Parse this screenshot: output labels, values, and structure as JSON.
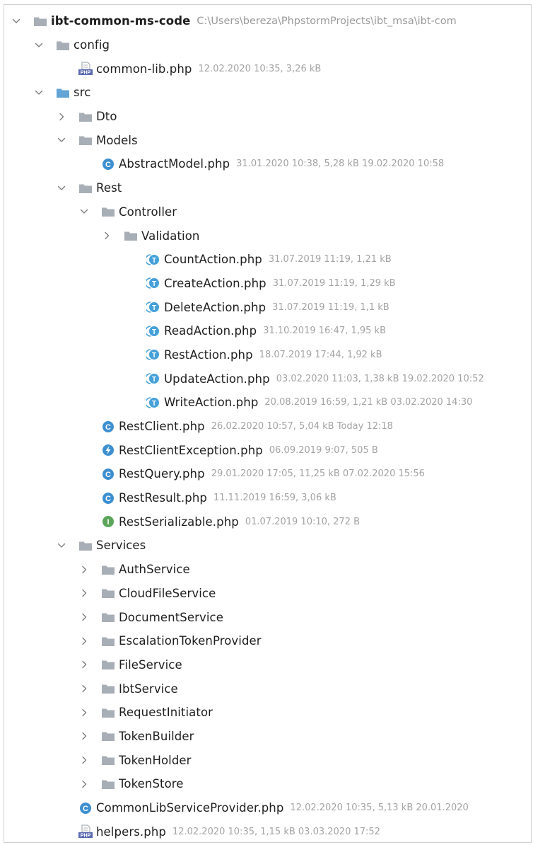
{
  "tree": {
    "rows": [
      {
        "type": "folder",
        "expanded": true,
        "depth": 0,
        "name": "ibt-common-ms-code",
        "meta": "C:\\Users\\bereza\\PhpstormProjects\\ibt_msa\\ibt-com",
        "bold": true,
        "icon": "project-folder-icon"
      },
      {
        "type": "folder",
        "expanded": true,
        "depth": 1,
        "name": "config",
        "meta": "",
        "icon": "folder-icon"
      },
      {
        "type": "file",
        "depth": 2,
        "name": "common-lib.php",
        "meta": "12.02.2020 10:35, 3,26 kB",
        "icon": "php-file-icon"
      },
      {
        "type": "folder",
        "expanded": true,
        "depth": 1,
        "name": "src",
        "meta": "",
        "icon": "source-folder-icon"
      },
      {
        "type": "folder",
        "expanded": false,
        "depth": 2,
        "name": "Dto",
        "meta": "",
        "icon": "folder-icon"
      },
      {
        "type": "folder",
        "expanded": true,
        "depth": 2,
        "name": "Models",
        "meta": "",
        "icon": "folder-icon"
      },
      {
        "type": "file",
        "depth": 3,
        "name": "AbstractModel.php",
        "meta": "31.01.2020 10:38, 5,28 kB 19.02.2020 10:58",
        "icon": "class-icon"
      },
      {
        "type": "folder",
        "expanded": true,
        "depth": 2,
        "name": "Rest",
        "meta": "",
        "icon": "folder-icon"
      },
      {
        "type": "folder",
        "expanded": true,
        "depth": 3,
        "name": "Controller",
        "meta": "",
        "icon": "folder-icon"
      },
      {
        "type": "folder",
        "expanded": false,
        "depth": 4,
        "name": "Validation",
        "meta": "",
        "icon": "folder-icon"
      },
      {
        "type": "file",
        "depth": 5,
        "name": "CountAction.php",
        "meta": "31.07.2019 11:19, 1,21 kB",
        "icon": "trait-icon"
      },
      {
        "type": "file",
        "depth": 5,
        "name": "CreateAction.php",
        "meta": "31.07.2019 11:19, 1,29 kB",
        "icon": "trait-icon"
      },
      {
        "type": "file",
        "depth": 5,
        "name": "DeleteAction.php",
        "meta": "31.07.2019 11:19, 1,1 kB",
        "icon": "trait-icon"
      },
      {
        "type": "file",
        "depth": 5,
        "name": "ReadAction.php",
        "meta": "31.10.2019 16:47, 1,95 kB",
        "icon": "trait-icon"
      },
      {
        "type": "file",
        "depth": 5,
        "name": "RestAction.php",
        "meta": "18.07.2019 17:44, 1,92 kB",
        "icon": "trait-icon"
      },
      {
        "type": "file",
        "depth": 5,
        "name": "UpdateAction.php",
        "meta": "03.02.2020 11:03, 1,38 kB 19.02.2020 10:52",
        "icon": "trait-icon"
      },
      {
        "type": "file",
        "depth": 5,
        "name": "WriteAction.php",
        "meta": "20.08.2019 16:59, 1,21 kB 03.02.2020 14:30",
        "icon": "trait-icon"
      },
      {
        "type": "file",
        "depth": 3,
        "name": "RestClient.php",
        "meta": "26.02.2020 10:57, 5,04 kB Today 12:18",
        "icon": "class-icon"
      },
      {
        "type": "file",
        "depth": 3,
        "name": "RestClientException.php",
        "meta": "06.09.2019 9:07, 505 B",
        "icon": "exception-icon"
      },
      {
        "type": "file",
        "depth": 3,
        "name": "RestQuery.php",
        "meta": "29.01.2020 17:05, 11,25 kB 07.02.2020 15:56",
        "icon": "class-icon"
      },
      {
        "type": "file",
        "depth": 3,
        "name": "RestResult.php",
        "meta": "11.11.2019 16:59, 3,06 kB",
        "icon": "class-icon"
      },
      {
        "type": "file",
        "depth": 3,
        "name": "RestSerializable.php",
        "meta": "01.07.2019 10:10, 272 B",
        "icon": "interface-icon"
      },
      {
        "type": "folder",
        "expanded": true,
        "depth": 2,
        "name": "Services",
        "meta": "",
        "icon": "folder-icon"
      },
      {
        "type": "folder",
        "expanded": false,
        "depth": 3,
        "name": "AuthService",
        "meta": "",
        "icon": "folder-icon"
      },
      {
        "type": "folder",
        "expanded": false,
        "depth": 3,
        "name": "CloudFileService",
        "meta": "",
        "icon": "folder-icon"
      },
      {
        "type": "folder",
        "expanded": false,
        "depth": 3,
        "name": "DocumentService",
        "meta": "",
        "icon": "folder-icon"
      },
      {
        "type": "folder",
        "expanded": false,
        "depth": 3,
        "name": "EscalationTokenProvider",
        "meta": "",
        "icon": "folder-icon"
      },
      {
        "type": "folder",
        "expanded": false,
        "depth": 3,
        "name": "FileService",
        "meta": "",
        "icon": "folder-icon"
      },
      {
        "type": "folder",
        "expanded": false,
        "depth": 3,
        "name": "IbtService",
        "meta": "",
        "icon": "folder-icon"
      },
      {
        "type": "folder",
        "expanded": false,
        "depth": 3,
        "name": "RequestInitiator",
        "meta": "",
        "icon": "folder-icon"
      },
      {
        "type": "folder",
        "expanded": false,
        "depth": 3,
        "name": "TokenBuilder",
        "meta": "",
        "icon": "folder-icon"
      },
      {
        "type": "folder",
        "expanded": false,
        "depth": 3,
        "name": "TokenHolder",
        "meta": "",
        "icon": "folder-icon"
      },
      {
        "type": "folder",
        "expanded": false,
        "depth": 3,
        "name": "TokenStore",
        "meta": "",
        "icon": "folder-icon"
      },
      {
        "type": "file",
        "depth": 2,
        "name": "CommonLibServiceProvider.php",
        "meta": "12.02.2020 10:35, 5,13 kB 20.01.2020",
        "icon": "class-icon"
      },
      {
        "type": "file",
        "depth": 2,
        "name": "helpers.php",
        "meta": "12.02.2020 10:35, 1,15 kB 03.03.2020 17:52",
        "icon": "php-file-icon"
      }
    ]
  },
  "colors": {
    "folder": "#a7aeb5",
    "source_folder": "#63a4d6",
    "class": "#3d8fcf",
    "trait": "#46a0d9",
    "interface": "#5aa55a",
    "exception": "#3d8fcf",
    "chevron": "#7d7d7d"
  }
}
